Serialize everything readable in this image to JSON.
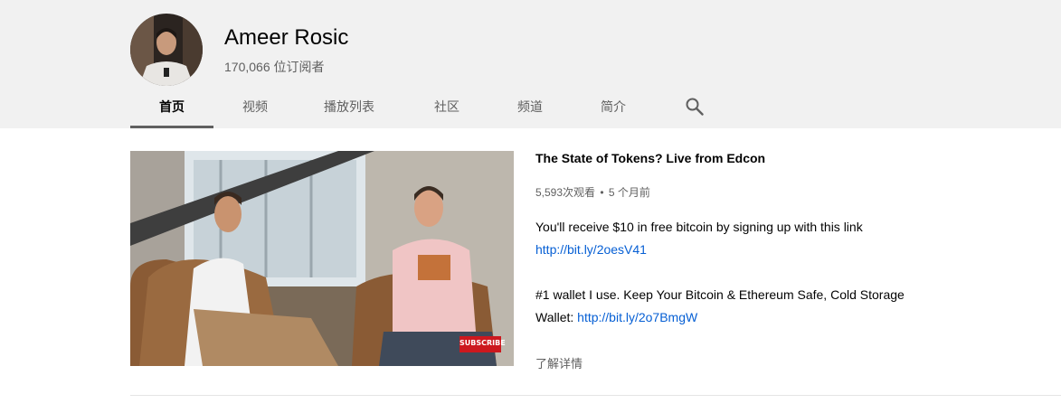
{
  "channel": {
    "name": "Ameer Rosic",
    "subscribers": "170,066 位订阅者"
  },
  "tabs": [
    {
      "label": "首页",
      "active": true
    },
    {
      "label": "视频",
      "active": false
    },
    {
      "label": "播放列表",
      "active": false
    },
    {
      "label": "社区",
      "active": false
    },
    {
      "label": "频道",
      "active": false
    },
    {
      "label": "简介",
      "active": false
    }
  ],
  "search_icon": "search-icon",
  "featured_video": {
    "title": "The State of Tokens? Live from Edcon",
    "views": "5,593次观看",
    "separator": "•",
    "age": "5 个月前",
    "thumbnail_badge": "SUBSCRIBE",
    "description": {
      "line1": "You'll receive $10 in free bitcoin by signing up with this link",
      "link1": "http://bit.ly/2oesV41",
      "line2": "#1 wallet I use. Keep Your Bitcoin & Ethereum Safe, Cold Storage",
      "line3_prefix": "Wallet: ",
      "link2": "http://bit.ly/2o7BmgW"
    },
    "more_label": "了解详情"
  },
  "colors": {
    "header_bg": "#f1f1f1",
    "link": "#065fd4",
    "secondary_text": "#606060",
    "subscribe_badge": "#cc181e"
  }
}
